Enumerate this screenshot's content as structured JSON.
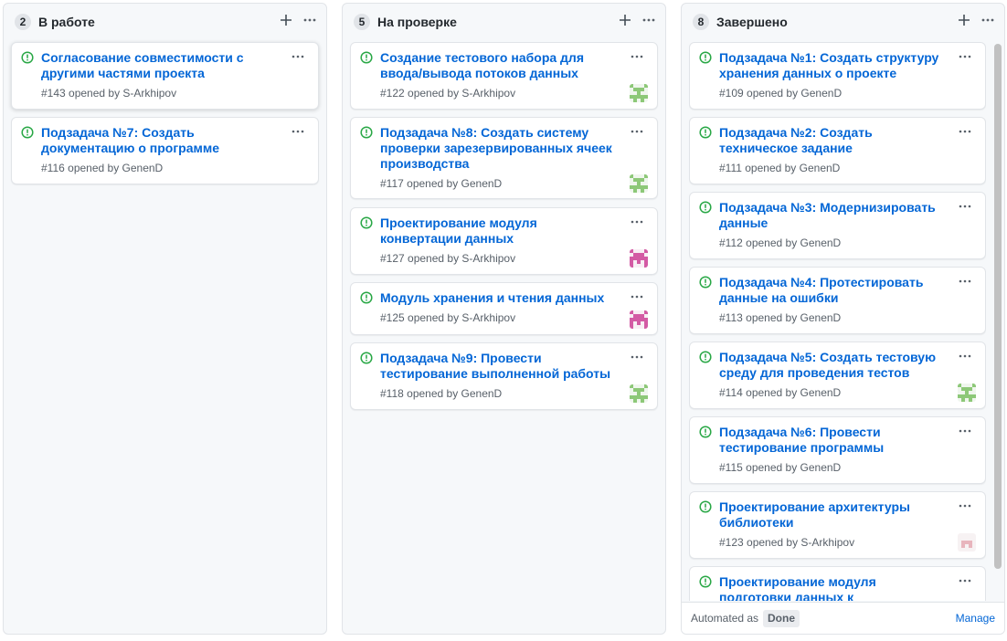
{
  "colors": {
    "accent": "#0366d6",
    "open_issue": "#28a745",
    "meta": "#586069",
    "avatar_green": "#8dc878",
    "avatar_pink": "#d35aa4",
    "avatar_light": "#e8b5bd"
  },
  "icons": {
    "add": "plus-icon",
    "more": "kebab-icon",
    "issue": "issue-opened-icon"
  },
  "columns": [
    {
      "count": "2",
      "title": "В работе",
      "cards": [
        {
          "title_line1": "Согласование совместимости с",
          "title_line2": "другими частями проекта",
          "meta": "#143 opened by S-Arkhipov",
          "avatar": ""
        },
        {
          "title_line1": "Подзадача №7: Создать",
          "title_line2": "документацию о программе",
          "meta": "#116 opened by GenenD",
          "avatar": ""
        }
      ]
    },
    {
      "count": "5",
      "title": "На проверке",
      "cards": [
        {
          "title_line1": "Создание тестового набора для",
          "title_line2": "ввода/вывода потоков данных",
          "meta": "#122 opened by S-Arkhipov",
          "avatar": "green"
        },
        {
          "title_line1": "Подзадача №8: Создать систему",
          "title_line2": "проверки зарезервированных ячеек",
          "title_line3": "производства",
          "meta": "#117 opened by GenenD",
          "avatar": "green"
        },
        {
          "title_line1": "Проектирование модуля",
          "title_line2": "конвертации данных",
          "meta": "#127 opened by S-Arkhipov",
          "avatar": "pink"
        },
        {
          "title_line1": "Модуль хранения и чтения данных",
          "meta": "#125 opened by S-Arkhipov",
          "avatar": "pink"
        },
        {
          "title_line1": "Подзадача №9: Провести",
          "title_line2": "тестирование выполненной работы",
          "meta": "#118 opened by GenenD",
          "avatar": "green"
        }
      ]
    },
    {
      "count": "8",
      "title": "Завершено",
      "cards": [
        {
          "title_line1": "Подзадача №1: Создать структуру",
          "title_line2": "хранения данных о проекте",
          "meta": "#109 opened by GenenD",
          "avatar": ""
        },
        {
          "title_line1": "Подзадача №2: Создать",
          "title_line2": "техническое задание",
          "meta": "#111 opened by GenenD",
          "avatar": ""
        },
        {
          "title_line1": "Подзадача №3: Модернизировать",
          "title_line2": "данные",
          "meta": "#112 opened by GenenD",
          "avatar": ""
        },
        {
          "title_line1": "Подзадача №4: Протестировать",
          "title_line2": "данные на ошибки",
          "meta": "#113 opened by GenenD",
          "avatar": ""
        },
        {
          "title_line1": "Подзадача №5: Создать тестовую",
          "title_line2": "среду для проведения тестов",
          "meta": "#114 opened by GenenD",
          "avatar": "green"
        },
        {
          "title_line1": "Подзадача №6: Провести",
          "title_line2": "тестирование программы",
          "meta": "#115 opened by GenenD",
          "avatar": ""
        },
        {
          "title_line1": "Проектирование архитектуры",
          "title_line2": "библиотеки",
          "meta": "#123 opened by S-Arkhipov",
          "avatar": "light"
        },
        {
          "title_line1": "Проектирование модуля",
          "title_line2": "подготовки данных к",
          "meta": "",
          "avatar": ""
        }
      ],
      "footer": {
        "automated_label": "Automated as",
        "automated_value": "Done",
        "manage_label": "Manage"
      }
    }
  ]
}
